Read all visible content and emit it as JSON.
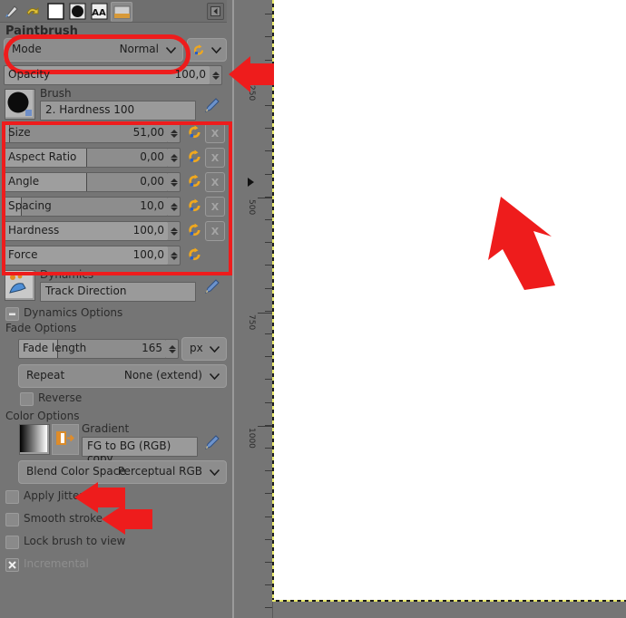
{
  "app": {
    "tool_title": "Paintbrush"
  },
  "toolbar": {
    "buttons": [
      {
        "name": "tool-options-icon",
        "label": ""
      },
      {
        "name": "undo-history-icon",
        "label": ""
      },
      {
        "name": "foreground-color-icon",
        "label": ""
      },
      {
        "name": "brushes-icon",
        "label": ""
      },
      {
        "name": "fonts-icon",
        "label": "AA"
      },
      {
        "name": "document-history-icon",
        "label": ""
      }
    ],
    "collapse_label": "collapse-panel"
  },
  "mode": {
    "label": "Mode",
    "value": "Normal"
  },
  "opacity": {
    "label": "Opacity",
    "value": "100,0",
    "fill_percent": 100
  },
  "brush": {
    "section_label": "Brush",
    "value": "2. Hardness 100"
  },
  "sliders": [
    {
      "label": "Size",
      "value": "51,00",
      "fill_percent": 3,
      "has_dynamics": true
    },
    {
      "label": "Aspect Ratio",
      "value": "0,00",
      "fill_percent": 50,
      "has_dynamics": true
    },
    {
      "label": "Angle",
      "value": "0,00",
      "fill_percent": 50,
      "has_dynamics": true
    },
    {
      "label": "Spacing",
      "value": "10,0",
      "fill_percent": 10,
      "has_dynamics": true
    },
    {
      "label": "Hardness",
      "value": "100,0",
      "fill_percent": 100,
      "has_dynamics": true
    },
    {
      "label": "Force",
      "value": "100,0",
      "fill_percent": 100,
      "has_dynamics": false
    }
  ],
  "dynamics": {
    "section_label": "Dynamics",
    "value": "Track Direction",
    "options_label": "Dynamics Options"
  },
  "fade": {
    "section_label": "Fade Options",
    "length_label": "Fade length",
    "length_value": "165",
    "unit_value": "px",
    "repeat_label": "Repeat",
    "repeat_value": "None (extend)",
    "reverse_label": "Reverse",
    "reverse_checked": false
  },
  "color_options": {
    "section_label": "Color Options",
    "gradient_label": "Gradient",
    "gradient_value": "FG to BG (RGB) copy",
    "blend_label": "Blend Color Space",
    "blend_value": "Perceptual RGB"
  },
  "checkboxes": [
    {
      "label": "Apply Jitter",
      "checked": false,
      "dim": false
    },
    {
      "label": "Smooth stroke",
      "checked": false,
      "dim": false
    },
    {
      "label": "Lock brush to view",
      "checked": false,
      "dim": false
    },
    {
      "label": "Incremental",
      "checked": true,
      "dim": true
    }
  ],
  "ruler": {
    "ticks": [
      "250",
      "500",
      "750",
      "1000"
    ]
  },
  "colors": {
    "panel_bg": "#757575",
    "annotation_red": "#ee1c1c",
    "canvas_white": "#ffffff",
    "guide_yellow": "#e8e86a"
  }
}
